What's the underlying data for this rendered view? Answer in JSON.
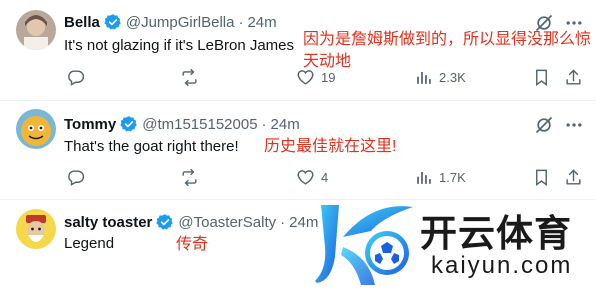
{
  "colors": {
    "verified": "#1d9bf0",
    "annotation": "#e0321e",
    "muted": "#536471"
  },
  "tweets": [
    {
      "name": "Bella",
      "handle": "@JumpGirlBella",
      "time": "24m",
      "text": "It's not glazing if it's LeBron James",
      "annotation": "因为是詹姆斯做到的，所以显得没那么惊天动地",
      "replies": "",
      "reposts": "",
      "likes": "19",
      "views": "2.3K"
    },
    {
      "name": "Tommy",
      "handle": "@tm1515152005",
      "time": "24m",
      "text": "That's the goat right there!",
      "annotation": "历史最佳就在这里!",
      "replies": "",
      "reposts": "",
      "likes": "4",
      "views": "1.7K"
    },
    {
      "name": "salty toaster",
      "handle": "@ToasterSalty",
      "time": "24m",
      "text": "Legend",
      "annotation": "传奇"
    }
  ],
  "watermark": {
    "cn": "开云体育",
    "en": "kaiyun.com"
  }
}
